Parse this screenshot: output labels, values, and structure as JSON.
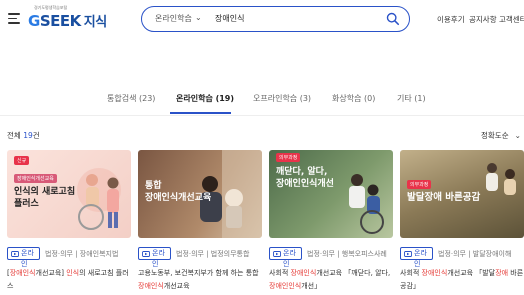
{
  "header": {
    "logo_sub": "경기도평생학습포털",
    "logo_g": "G",
    "logo_rest": "SEEK",
    "logo_ko": "지식",
    "search_category": "온라인학습",
    "search_value": "장애인식",
    "util_links": [
      "이용후기",
      "공지사항",
      "고객센터"
    ]
  },
  "tabs": [
    {
      "label": "통합검색 (23)",
      "active": false
    },
    {
      "label": "온라인학습 (19)",
      "active": true
    },
    {
      "label": "오프라인학습 (3)",
      "active": false
    },
    {
      "label": "화상학습 (0)",
      "active": false
    },
    {
      "label": "기타 (1)",
      "active": false
    }
  ],
  "results": {
    "total_prefix": "전체 ",
    "total_count": "19",
    "total_suffix": "건",
    "sort_label": "정확도순"
  },
  "cards": [
    {
      "badge_new": "신규",
      "badge_tag": "장애인식개선교육",
      "thumb_title": "인식의 새로고침\n플러스",
      "online_label": "온라인",
      "meta": "법정·의무 | 장애인복지법",
      "desc": [
        {
          "t": "[",
          "hl": false
        },
        {
          "t": "장애인식",
          "hl": true
        },
        {
          "t": "개선교육] ",
          "hl": false
        },
        {
          "t": "인식",
          "hl": true
        },
        {
          "t": "의 새로고침 플러스",
          "hl": false
        }
      ]
    },
    {
      "thumb_title": "통합\n장애인식개선교육",
      "online_label": "온라인",
      "meta": "법정·의무 | 법정의무통합",
      "desc": [
        {
          "t": "고용노동부, 보건복지부가 함께 하는 통합 ",
          "hl": false
        },
        {
          "t": "장애인식",
          "hl": true
        },
        {
          "t": "개선교육",
          "hl": false
        }
      ]
    },
    {
      "badge_tag": "의무과정",
      "thumb_title": "깨닫다, 알다,\n장애인인식개선",
      "online_label": "온라인",
      "meta": "법정·의무 | 행복오피스사례",
      "desc": [
        {
          "t": "사회적 ",
          "hl": false
        },
        {
          "t": "장애인식",
          "hl": true
        },
        {
          "t": "개선교육 「깨닫다, 알다, ",
          "hl": false
        },
        {
          "t": "장애인인식",
          "hl": true
        },
        {
          "t": "개선」",
          "hl": false
        }
      ]
    },
    {
      "badge_tag": "의무과정",
      "thumb_title": "발달장애 바른공감",
      "online_label": "온라인",
      "meta": "법정·의무 | 발달장애이해",
      "desc": [
        {
          "t": "사회적 ",
          "hl": false
        },
        {
          "t": "장애인식",
          "hl": true
        },
        {
          "t": "개선교육 「발달",
          "hl": false
        },
        {
          "t": "장애",
          "hl": true
        },
        {
          "t": " 바른공감」",
          "hl": false
        }
      ]
    }
  ],
  "colors": {
    "accent": "#2a52c8",
    "highlight": "#e53935",
    "card1_bg": "#f7d9d2",
    "card2_bg": "#b88f6e",
    "card3_bg": "#6d8a64",
    "card4_bg": "#9a8a62"
  }
}
